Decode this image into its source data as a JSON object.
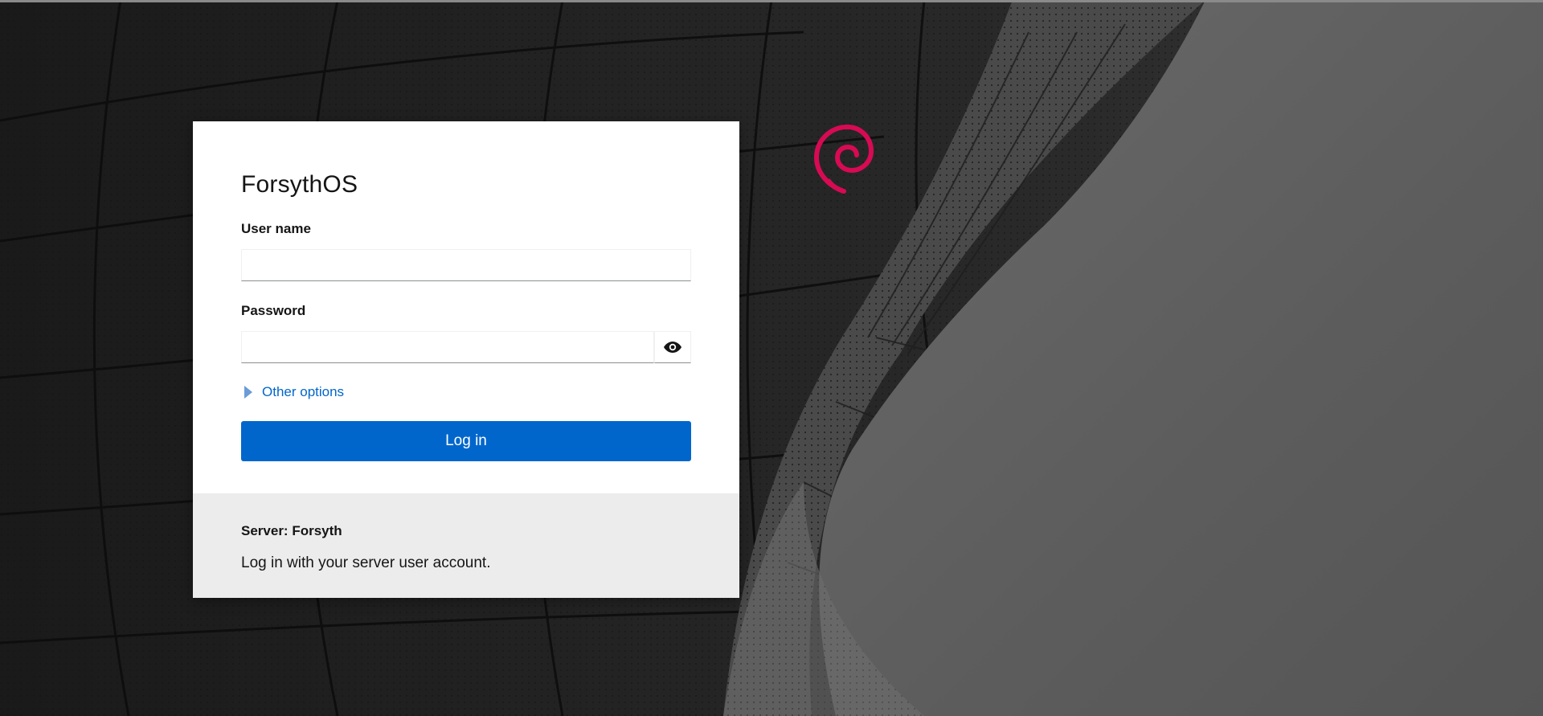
{
  "background": {
    "logo_icon": "debian-swirl-icon",
    "logo_color": "#d70a53"
  },
  "login": {
    "title": "ForsythOS",
    "username_label": "User name",
    "username_value": "",
    "password_label": "Password",
    "password_value": "",
    "reveal_icon": "eye-icon",
    "other_options_label": "Other options",
    "other_options_icon": "caret-right-icon",
    "login_button_label": "Log in",
    "accent_color": "#0066cc"
  },
  "footer": {
    "server_label": "Server: Forsyth",
    "hint": "Log in with your server user account."
  }
}
